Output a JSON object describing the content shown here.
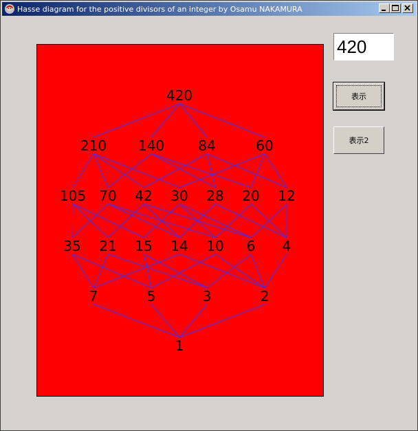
{
  "window": {
    "title": "Hasse diagram for the positive divisors of an integer by Osamu NAKAMURA",
    "minimize": "minimize",
    "maximize": "maximize",
    "close": "close"
  },
  "controls": {
    "number_value": "420",
    "show_button": "表示",
    "show2_button": "表示2"
  },
  "diagram": {
    "background": "#ff0000",
    "edge_color": "#3333ff",
    "levels": [
      [
        "420"
      ],
      [
        "210",
        "140",
        "84",
        "60"
      ],
      [
        "105",
        "70",
        "42",
        "30",
        "28",
        "20",
        "12"
      ],
      [
        "35",
        "21",
        "15",
        "14",
        "10",
        "6",
        "4"
      ],
      [
        "7",
        "5",
        "3",
        "2"
      ],
      [
        "1"
      ]
    ]
  }
}
